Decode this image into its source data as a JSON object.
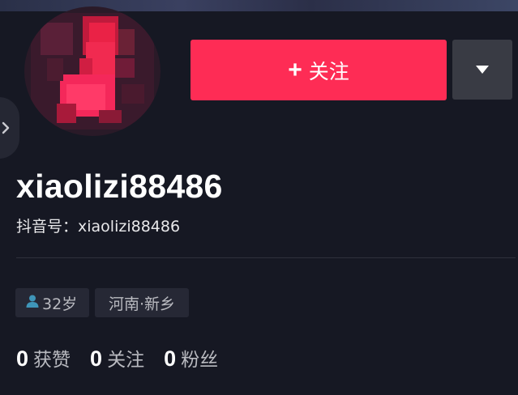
{
  "profile": {
    "username": "xiaolizi88486",
    "douyin_id_label": "抖音号：",
    "douyin_id": "xiaolizi88486"
  },
  "actions": {
    "follow_plus": "+",
    "follow_label": "关注"
  },
  "tags": {
    "age": "32岁",
    "location": "河南·新乡"
  },
  "stats": [
    {
      "value": "0",
      "label": "获赞"
    },
    {
      "value": "0",
      "label": "关注"
    },
    {
      "value": "0",
      "label": "粉丝"
    }
  ],
  "colors": {
    "background": "#161823",
    "accent": "#fe2c55",
    "secondary_button": "#393b44",
    "tag_background": "#262835",
    "muted_text": "#b9bac0",
    "age_icon": "#3f95b8"
  },
  "icons": {
    "follow": "plus-icon",
    "more": "caret-down-icon",
    "side": "chevron-right-icon",
    "age": "user-icon"
  }
}
